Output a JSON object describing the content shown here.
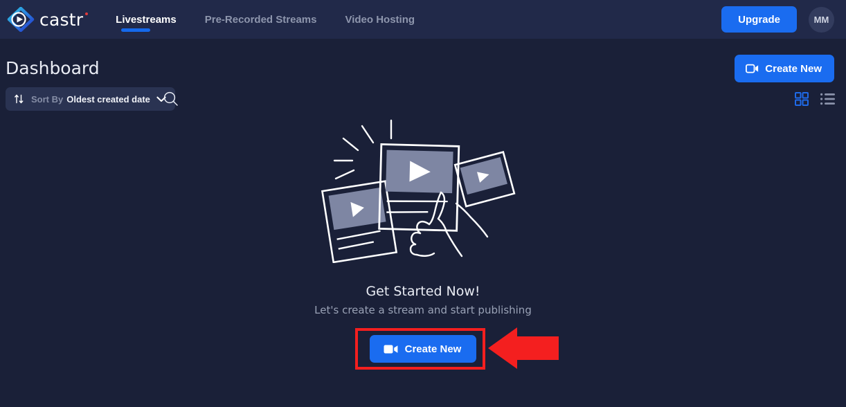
{
  "brand": {
    "name": "castr",
    "logo_icon": "castr-play-diamond-logo",
    "accent": "#1a6cf0",
    "dot_color": "#e23a3a"
  },
  "topnav": {
    "tabs": [
      {
        "label": "Livestreams",
        "active": true
      },
      {
        "label": "Pre-Recorded Streams",
        "active": false
      },
      {
        "label": "Video Hosting",
        "active": false
      }
    ],
    "upgrade_label": "Upgrade",
    "avatar_initials": "MM"
  },
  "page": {
    "title": "Dashboard",
    "create_new_label": "Create New",
    "create_new_icon": "video-camera-icon"
  },
  "toolbar": {
    "sort_icon": "sort-arrows-icon",
    "sort_prefix": "Sort By",
    "sort_value": "Oldest created date",
    "sort_chevron_icon": "chevron-down-icon",
    "search_icon": "search-icon",
    "view_grid_icon": "grid-view-icon",
    "view_list_icon": "list-view-icon",
    "view_active": "grid"
  },
  "empty_state": {
    "illustration": "video-cards-hand-pointing-illustration",
    "title": "Get Started Now!",
    "subtitle": "Let's create a stream and start publishing",
    "cta_label": "Create New",
    "cta_icon": "video-camera-icon"
  },
  "annotations": {
    "highlight_color": "#f41f1f",
    "highlight_target": "create-new-cta",
    "arrow_icon": "left-pointing-arrow"
  }
}
